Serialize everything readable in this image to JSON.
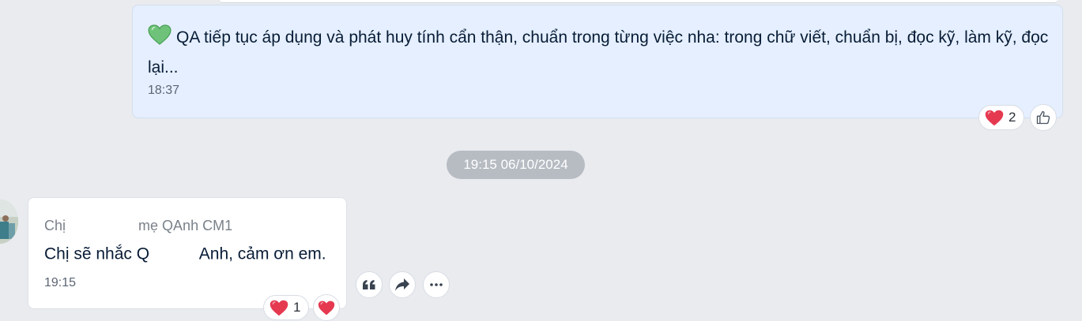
{
  "messages": {
    "outgoing": {
      "emoji_icon": "green-heart-icon",
      "text": "QA tiếp tục áp dụng và phát huy tính cẩn thận, chuẩn trong từng việc nha: trong chữ viết, chuẩn bị, đọc kỹ, làm kỹ, đọc lại...",
      "time": "18:37",
      "reaction": {
        "icon": "heart-icon",
        "count": "2"
      },
      "react_button_icon": "thumbs-up-icon"
    },
    "date_divider": "19:15 06/10/2024",
    "incoming": {
      "sender_prefix": "Chị",
      "sender_suffix": "mẹ QAnh CM1",
      "text_before": "Chị sẽ nhắc Q",
      "text_after": "Anh, cảm ơn em.",
      "time": "19:15",
      "reaction": {
        "icon": "heart-icon",
        "count": "1"
      },
      "react_button_icon": "heart-icon",
      "actions": [
        "quote-icon",
        "forward-icon",
        "more-icon"
      ]
    }
  },
  "colors": {
    "background": "#e9ebef",
    "outgoing_bubble": "#e5efff",
    "incoming_bubble": "#ffffff",
    "heart": "#e53950",
    "green_heart": "#6fc27a"
  }
}
